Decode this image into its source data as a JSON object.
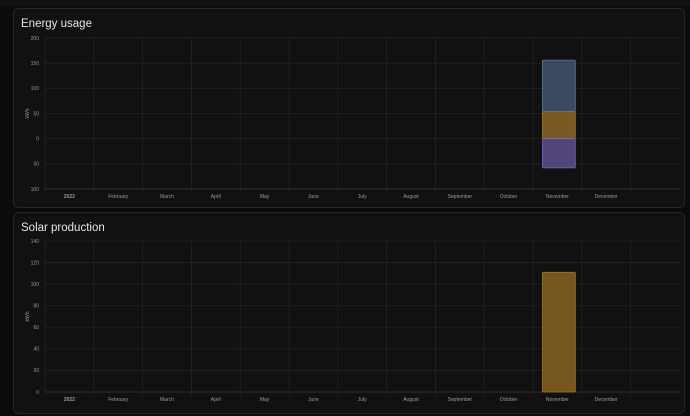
{
  "chart_data": [
    {
      "type": "bar",
      "stacked": true,
      "title": "Energy usage",
      "ylabel": "kWh",
      "xlabel": "",
      "ylim": [
        -100,
        200
      ],
      "yticks": [
        200,
        150,
        100,
        50,
        0,
        -50,
        -100
      ],
      "ytick_labels": [
        "200",
        "150",
        "100",
        "50",
        "0",
        "50",
        "100"
      ],
      "categories": [
        "2022",
        "February",
        "March",
        "April",
        "May",
        "June",
        "July",
        "August",
        "September",
        "October",
        "November",
        "December"
      ],
      "grid": true,
      "series": [
        {
          "color": "#7a5a22",
          "border": "#a07a30",
          "values": [
            0,
            0,
            0,
            0,
            0,
            0,
            0,
            0,
            0,
            0,
            54,
            0
          ]
        },
        {
          "color": "#3a4862",
          "border": "#61789f",
          "values": [
            0,
            0,
            0,
            0,
            0,
            0,
            0,
            0,
            0,
            0,
            102,
            0
          ]
        },
        {
          "color": "#52457a",
          "border": "#7d66b8",
          "values": [
            0,
            0,
            0,
            0,
            0,
            0,
            0,
            0,
            0,
            0,
            -58,
            0
          ]
        }
      ]
    },
    {
      "type": "bar",
      "title": "Solar production",
      "ylabel": "kWh",
      "xlabel": "",
      "ylim": [
        0,
        140
      ],
      "yticks": [
        140,
        120,
        100,
        80,
        60,
        40,
        20,
        0
      ],
      "ytick_labels": [
        "140",
        "120",
        "100",
        "80",
        "60",
        "40",
        "20",
        "0"
      ],
      "categories": [
        "2022",
        "February",
        "March",
        "April",
        "May",
        "June",
        "July",
        "August",
        "September",
        "October",
        "November",
        "December"
      ],
      "grid": true,
      "series": [
        {
          "color": "#765620",
          "border": "#a07a30",
          "values": [
            0,
            0,
            0,
            0,
            0,
            0,
            0,
            0,
            0,
            0,
            111,
            0
          ]
        }
      ]
    }
  ]
}
